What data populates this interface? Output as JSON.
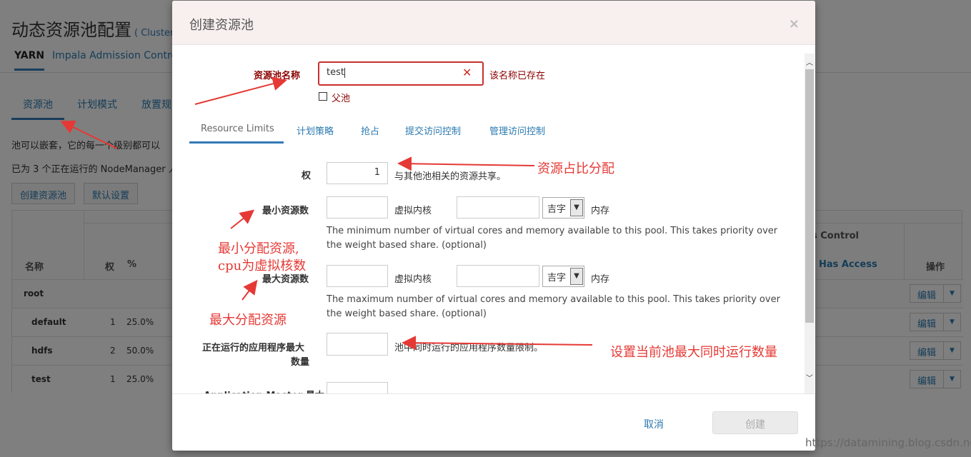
{
  "background": {
    "page_title": "动态资源池配置",
    "cluster_label": "( Cluster",
    "top_tabs": [
      "YARN",
      "Impala Admission Control"
    ],
    "sub_tabs": [
      "资源池",
      "计划模式",
      "放置规"
    ],
    "description_1": "池可以嵌套，它的每一个级别都可以",
    "description_2": "已为 3 个正在运行的 NodeManager 人",
    "create_pool_button": "创建资源池",
    "default_settings_button": "默认设置",
    "table": {
      "col_name": "名称",
      "col_weight": "权",
      "col_percent": "%",
      "col_access_control": "s Control",
      "col_has_access": "Has Access",
      "col_actions": "操作",
      "rows": [
        {
          "name": "root",
          "weight": "",
          "percent": ""
        },
        {
          "name": "default",
          "weight": "1",
          "percent": "25.0%"
        },
        {
          "name": "hdfs",
          "weight": "2",
          "percent": "50.0%"
        },
        {
          "name": "test",
          "weight": "1",
          "percent": "25.0%"
        }
      ],
      "edit_label": "编辑"
    }
  },
  "modal": {
    "title": "创建资源池",
    "close_symbol": "×",
    "name_label": "资源池名称",
    "name_value": "test",
    "name_error": "该名称已存在",
    "parent_pool_label": "父池",
    "tabs": [
      "Resource Limits",
      "计划策略",
      "抢占",
      "提交访问控制",
      "管理访问控制"
    ],
    "weight": {
      "label": "权",
      "value": "1",
      "help": "与其他池相关的资源共享。"
    },
    "min_resources": {
      "label": "最小资源数",
      "vcores_label": "虚拟内核",
      "unit": "吉字",
      "memory_label": "内存",
      "help": "The minimum number of virtual cores and memory available to this pool. This takes priority over the weight based share. (optional)"
    },
    "max_resources": {
      "label": "最大资源数",
      "vcores_label": "虚拟内核",
      "unit": "吉字",
      "memory_label": "内存",
      "help": "The maximum number of virtual cores and memory available to this pool. This takes priority over the weight based share. (optional)"
    },
    "max_running_apps": {
      "label_line1": "正在运行的应用程序最大",
      "label_line2": "数量",
      "help": "池中同时运行的应用程序数量限制。"
    },
    "am_share_label": "Application Master 最大",
    "cancel_label": "取消",
    "create_label": "创建"
  },
  "annotations": {
    "weight_note": "资源占比分配",
    "min_note_line1": "最小分配资源,",
    "min_note_line2": "cpu为虚拟核数",
    "max_note": "最大分配资源",
    "running_note": "设置当前池最大同时运行数量",
    "color": "#e53935"
  },
  "watermark": "https://datamining.blog.csdn.net"
}
